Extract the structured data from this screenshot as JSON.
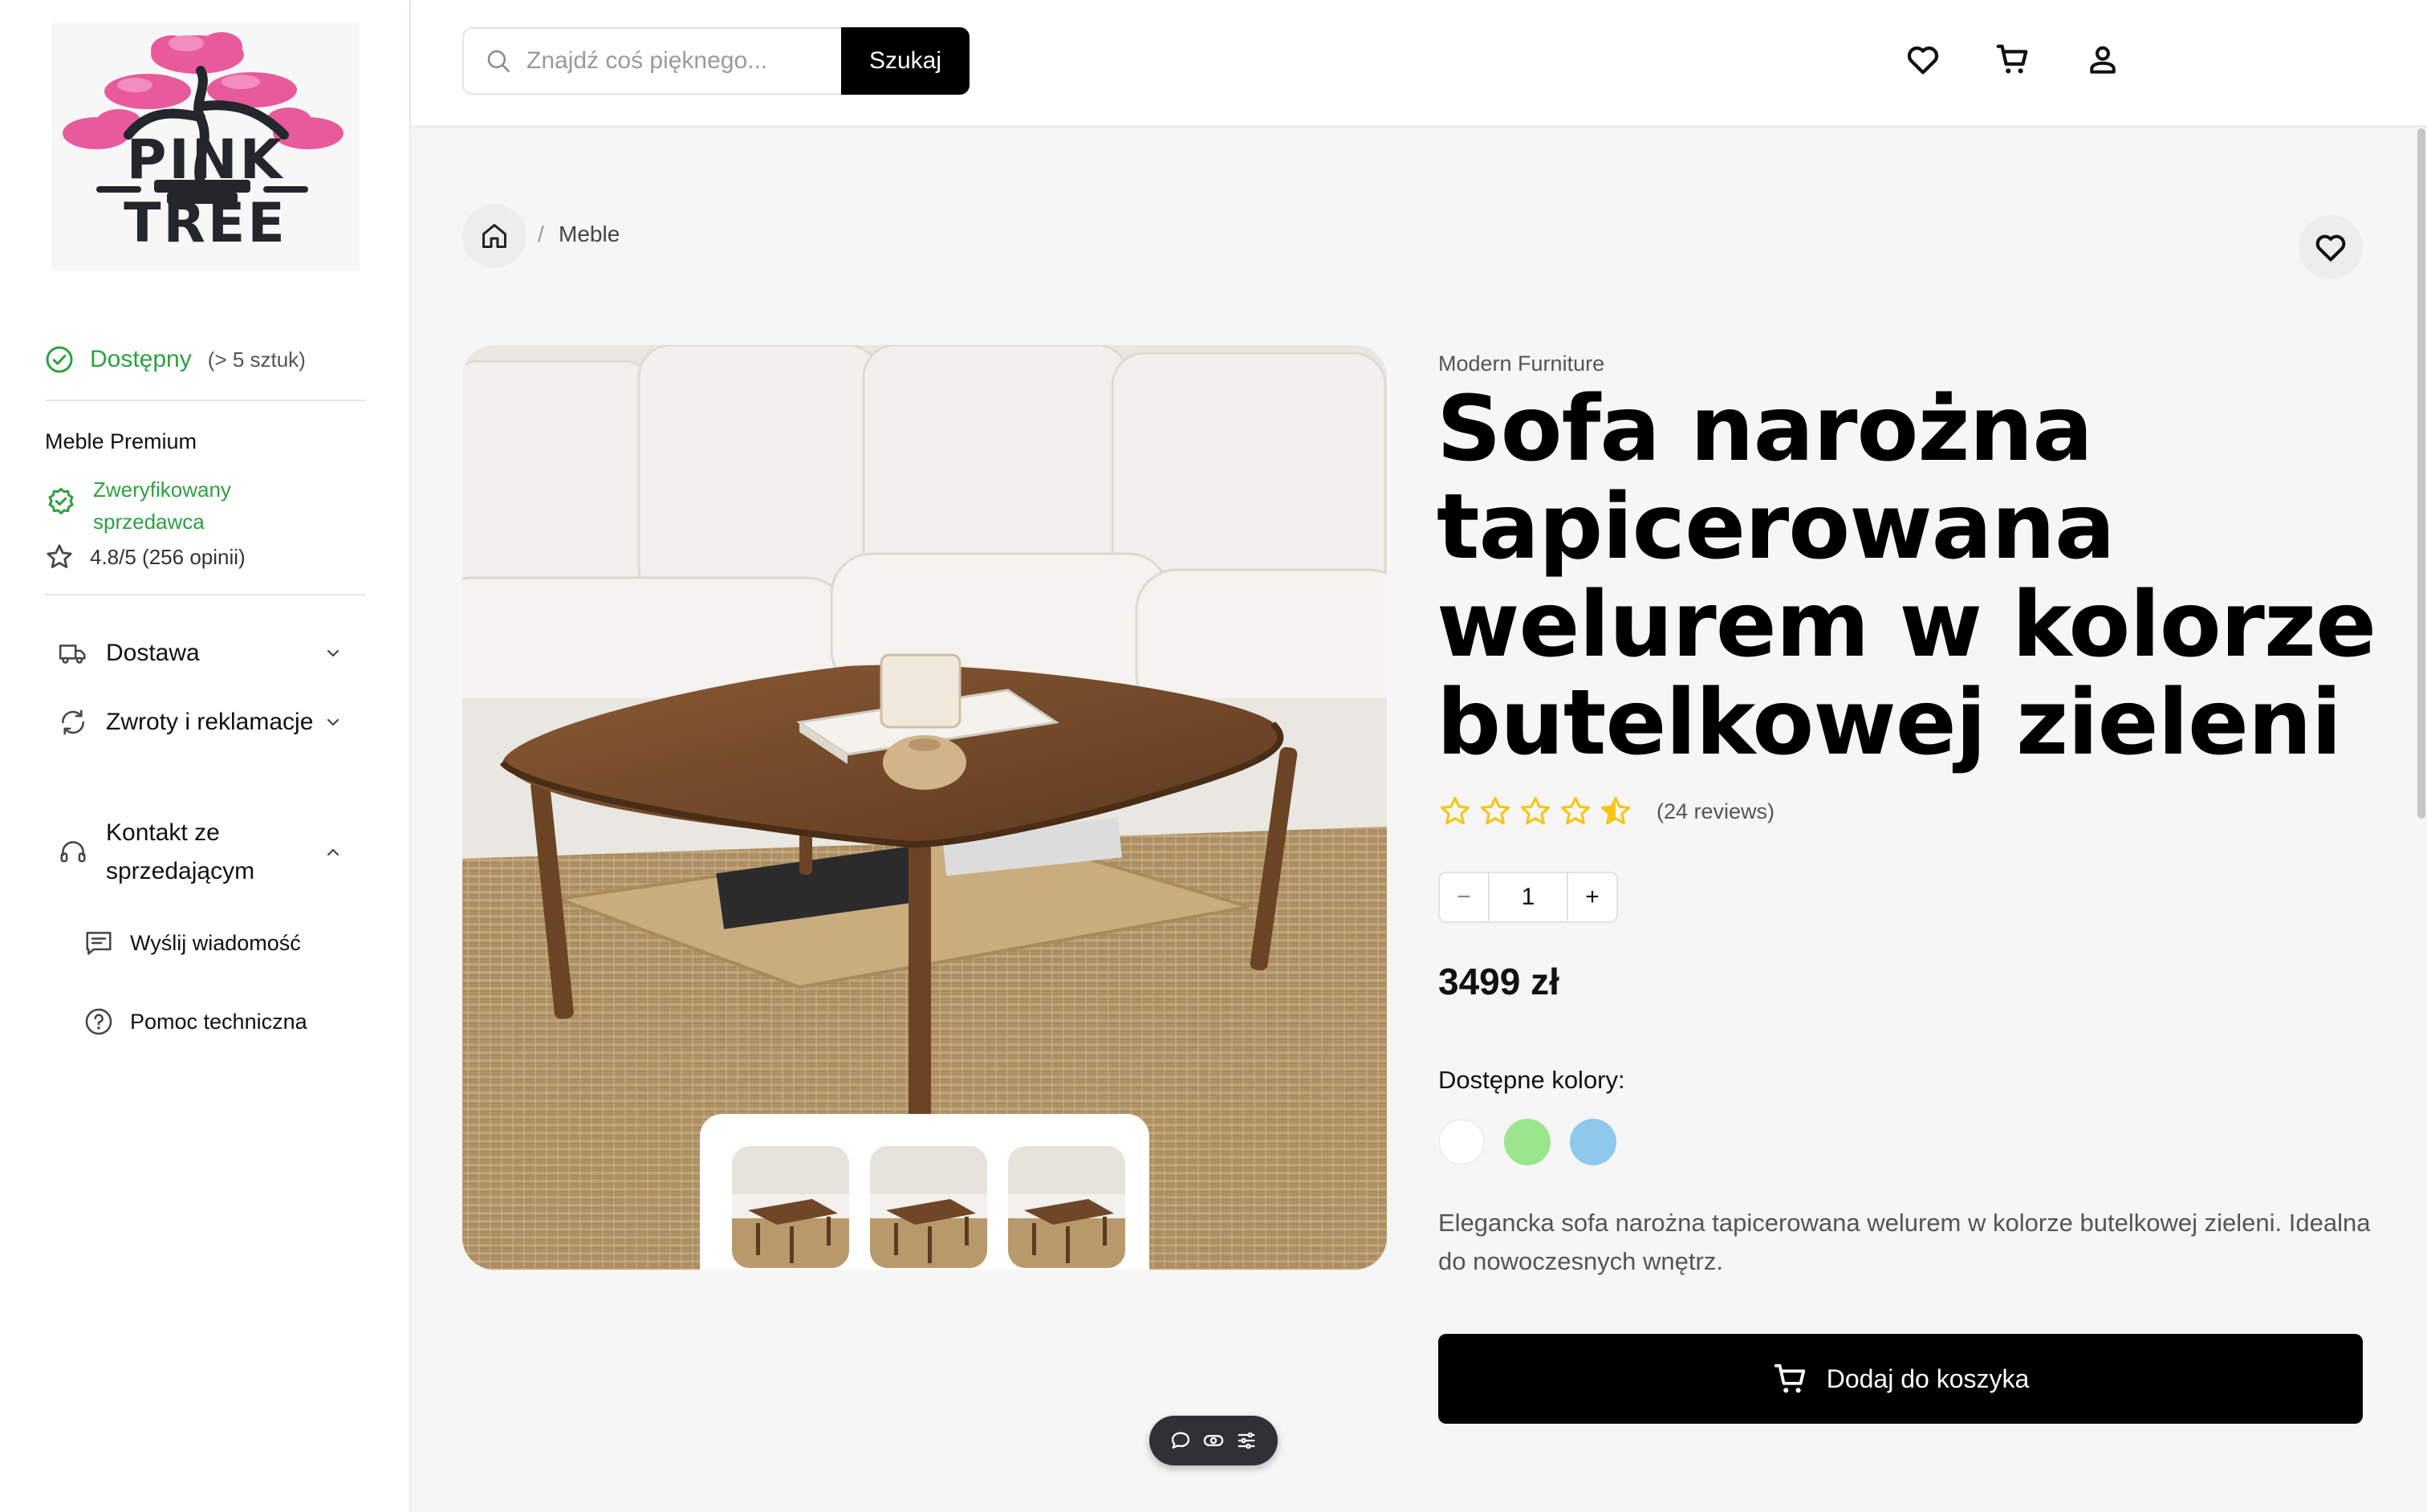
{
  "logo": {
    "text": "PINK TREE"
  },
  "sidebar": {
    "stock": {
      "label": "Dostępny",
      "count": "(> 5 sztuk)"
    },
    "seller": {
      "name": "Meble Premium",
      "verified": "Zweryfikowany sprzedawca",
      "rating": "4.8/5 (256 opinii)"
    },
    "accordion": [
      {
        "label": "Dostawa",
        "icon": "truck-icon",
        "expanded": false
      },
      {
        "label": "Zwroty i reklamacje",
        "icon": "returns-icon",
        "expanded": false
      },
      {
        "label": "Kontakt ze sprzedającym",
        "icon": "support-icon",
        "expanded": true
      }
    ],
    "contact_items": [
      {
        "label": "Wyślij wiadomość",
        "icon": "message-icon"
      },
      {
        "label": "Pomoc techniczna",
        "icon": "help-icon"
      }
    ]
  },
  "header": {
    "search_placeholder": "Znajdź coś pięknego...",
    "search_button": "Szukaj",
    "icons": [
      "heart-icon",
      "cart-icon",
      "user-icon"
    ]
  },
  "breadcrumb": {
    "home_icon": "home-icon",
    "separator": "/",
    "current": "Meble"
  },
  "product": {
    "brand": "Modern Furniture",
    "title": "Sofa narożna tapicerowana welurem w kolorze butelkowej zieleni",
    "rating_stars": 4.5,
    "reviews": "(24 reviews)",
    "quantity": "1",
    "qty_minus": "−",
    "qty_plus": "+",
    "price": "3499 zł",
    "colors_label": "Dostępne kolory:",
    "colors": [
      "#ffffff",
      "#9be58c",
      "#8ec8ea"
    ],
    "description": "Elegancka sofa narożna tapicerowana welurem w kolorze butelkowej zieleni. Idealna do nowoczesnych wnętrz.",
    "add_to_cart": "Dodaj do koszyka",
    "thumbnail_count": 3
  },
  "theme": {
    "accent_green": "#2ea043",
    "star_color": "#f5c518",
    "logo_pink": "#e85a9c"
  }
}
